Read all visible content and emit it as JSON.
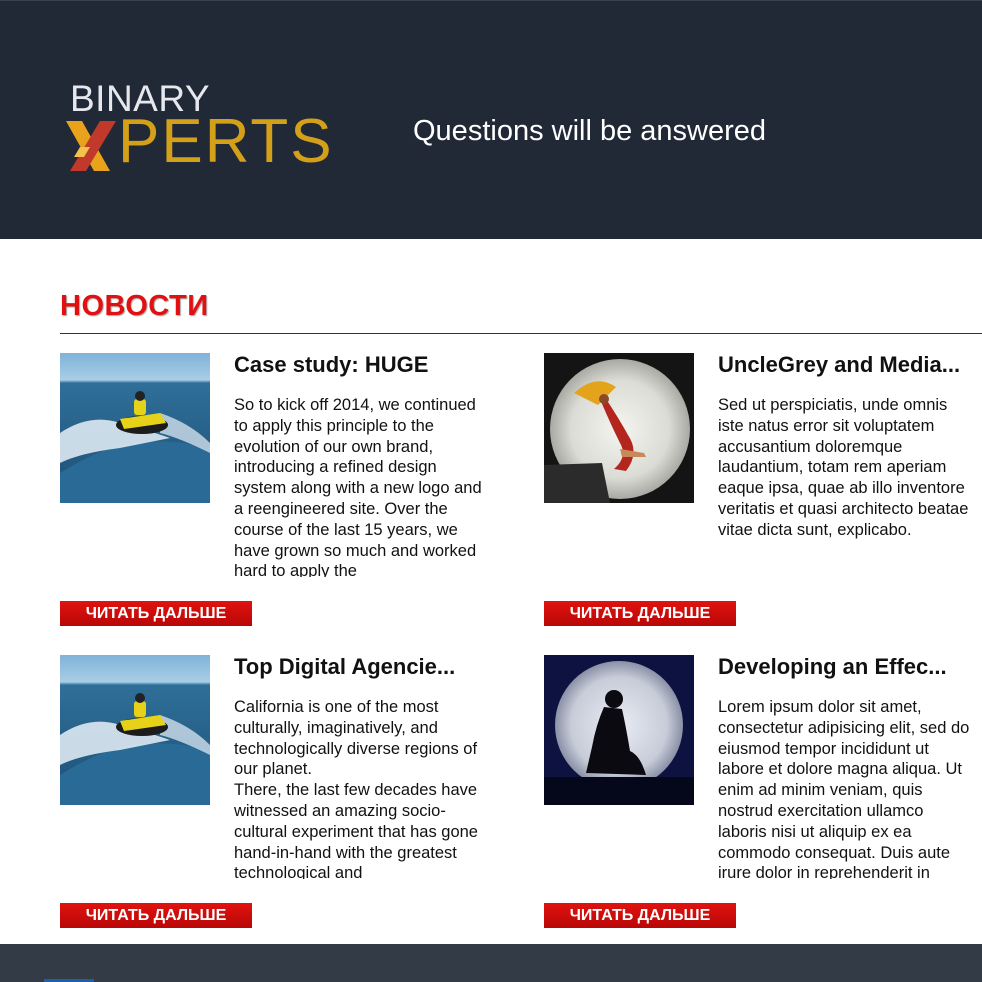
{
  "header": {
    "logo": {
      "line1": "BINARY",
      "line2": "PERTS"
    },
    "tagline": "Questions will be answered"
  },
  "news": {
    "title": "НОВОСТИ",
    "articles": [
      {
        "title": "Case study: HUGE",
        "text": "So to kick off 2014, we continued to apply this principle to the evolution of our own brand, introducing a refined design system along with a new logo and a reengineered site. Over the course of the last 15 years, we have grown so much and worked hard to apply the",
        "button": "ЧИТАТЬ ДАЛЬШЕ",
        "image_icon": "jet-ski-image"
      },
      {
        "title": "UncleGrey and Media...",
        "text": "Sed ut perspiciatis, unde omnis iste natus error sit voluptatem accusantium doloremque laudantium, totam rem aperiam eaque ipsa, quae ab illo inventore veritatis et quasi architecto beatae vitae dicta sunt, explicabo.",
        "button": "ЧИТАТЬ ДАЛЬШЕ",
        "image_icon": "moon-woman-umbrella-image"
      },
      {
        "title": "Top Digital Agencie...",
        "text": "California is one of the most culturally, imaginatively, and technologically diverse regions of our planet.\nThere, the last few decades have witnessed an amazing socio-cultural experiment that has gone hand-in-hand with the greatest technological and",
        "button": "ЧИТАТЬ ДАЛЬШЕ",
        "image_icon": "jet-ski-image"
      },
      {
        "title": "Developing an Effec...",
        "text": "Lorem ipsum dolor sit amet, consectetur adipisicing elit, sed do eiusmod tempor incididunt ut labore et dolore magna aliqua. Ut enim ad minim veniam, quis nostrud exercitation ullamco laboris nisi ut aliquip ex ea commodo consequat. Duis aute irure dolor in reprehenderit in",
        "button": "ЧИТАТЬ ДАЛЬШЕ",
        "image_icon": "moon-silhouette-image"
      }
    ]
  },
  "colors": {
    "header_bg": "#212937",
    "accent_red": "#e21010",
    "logo_gold": "#d4a019",
    "footer_bg": "#333b47"
  }
}
